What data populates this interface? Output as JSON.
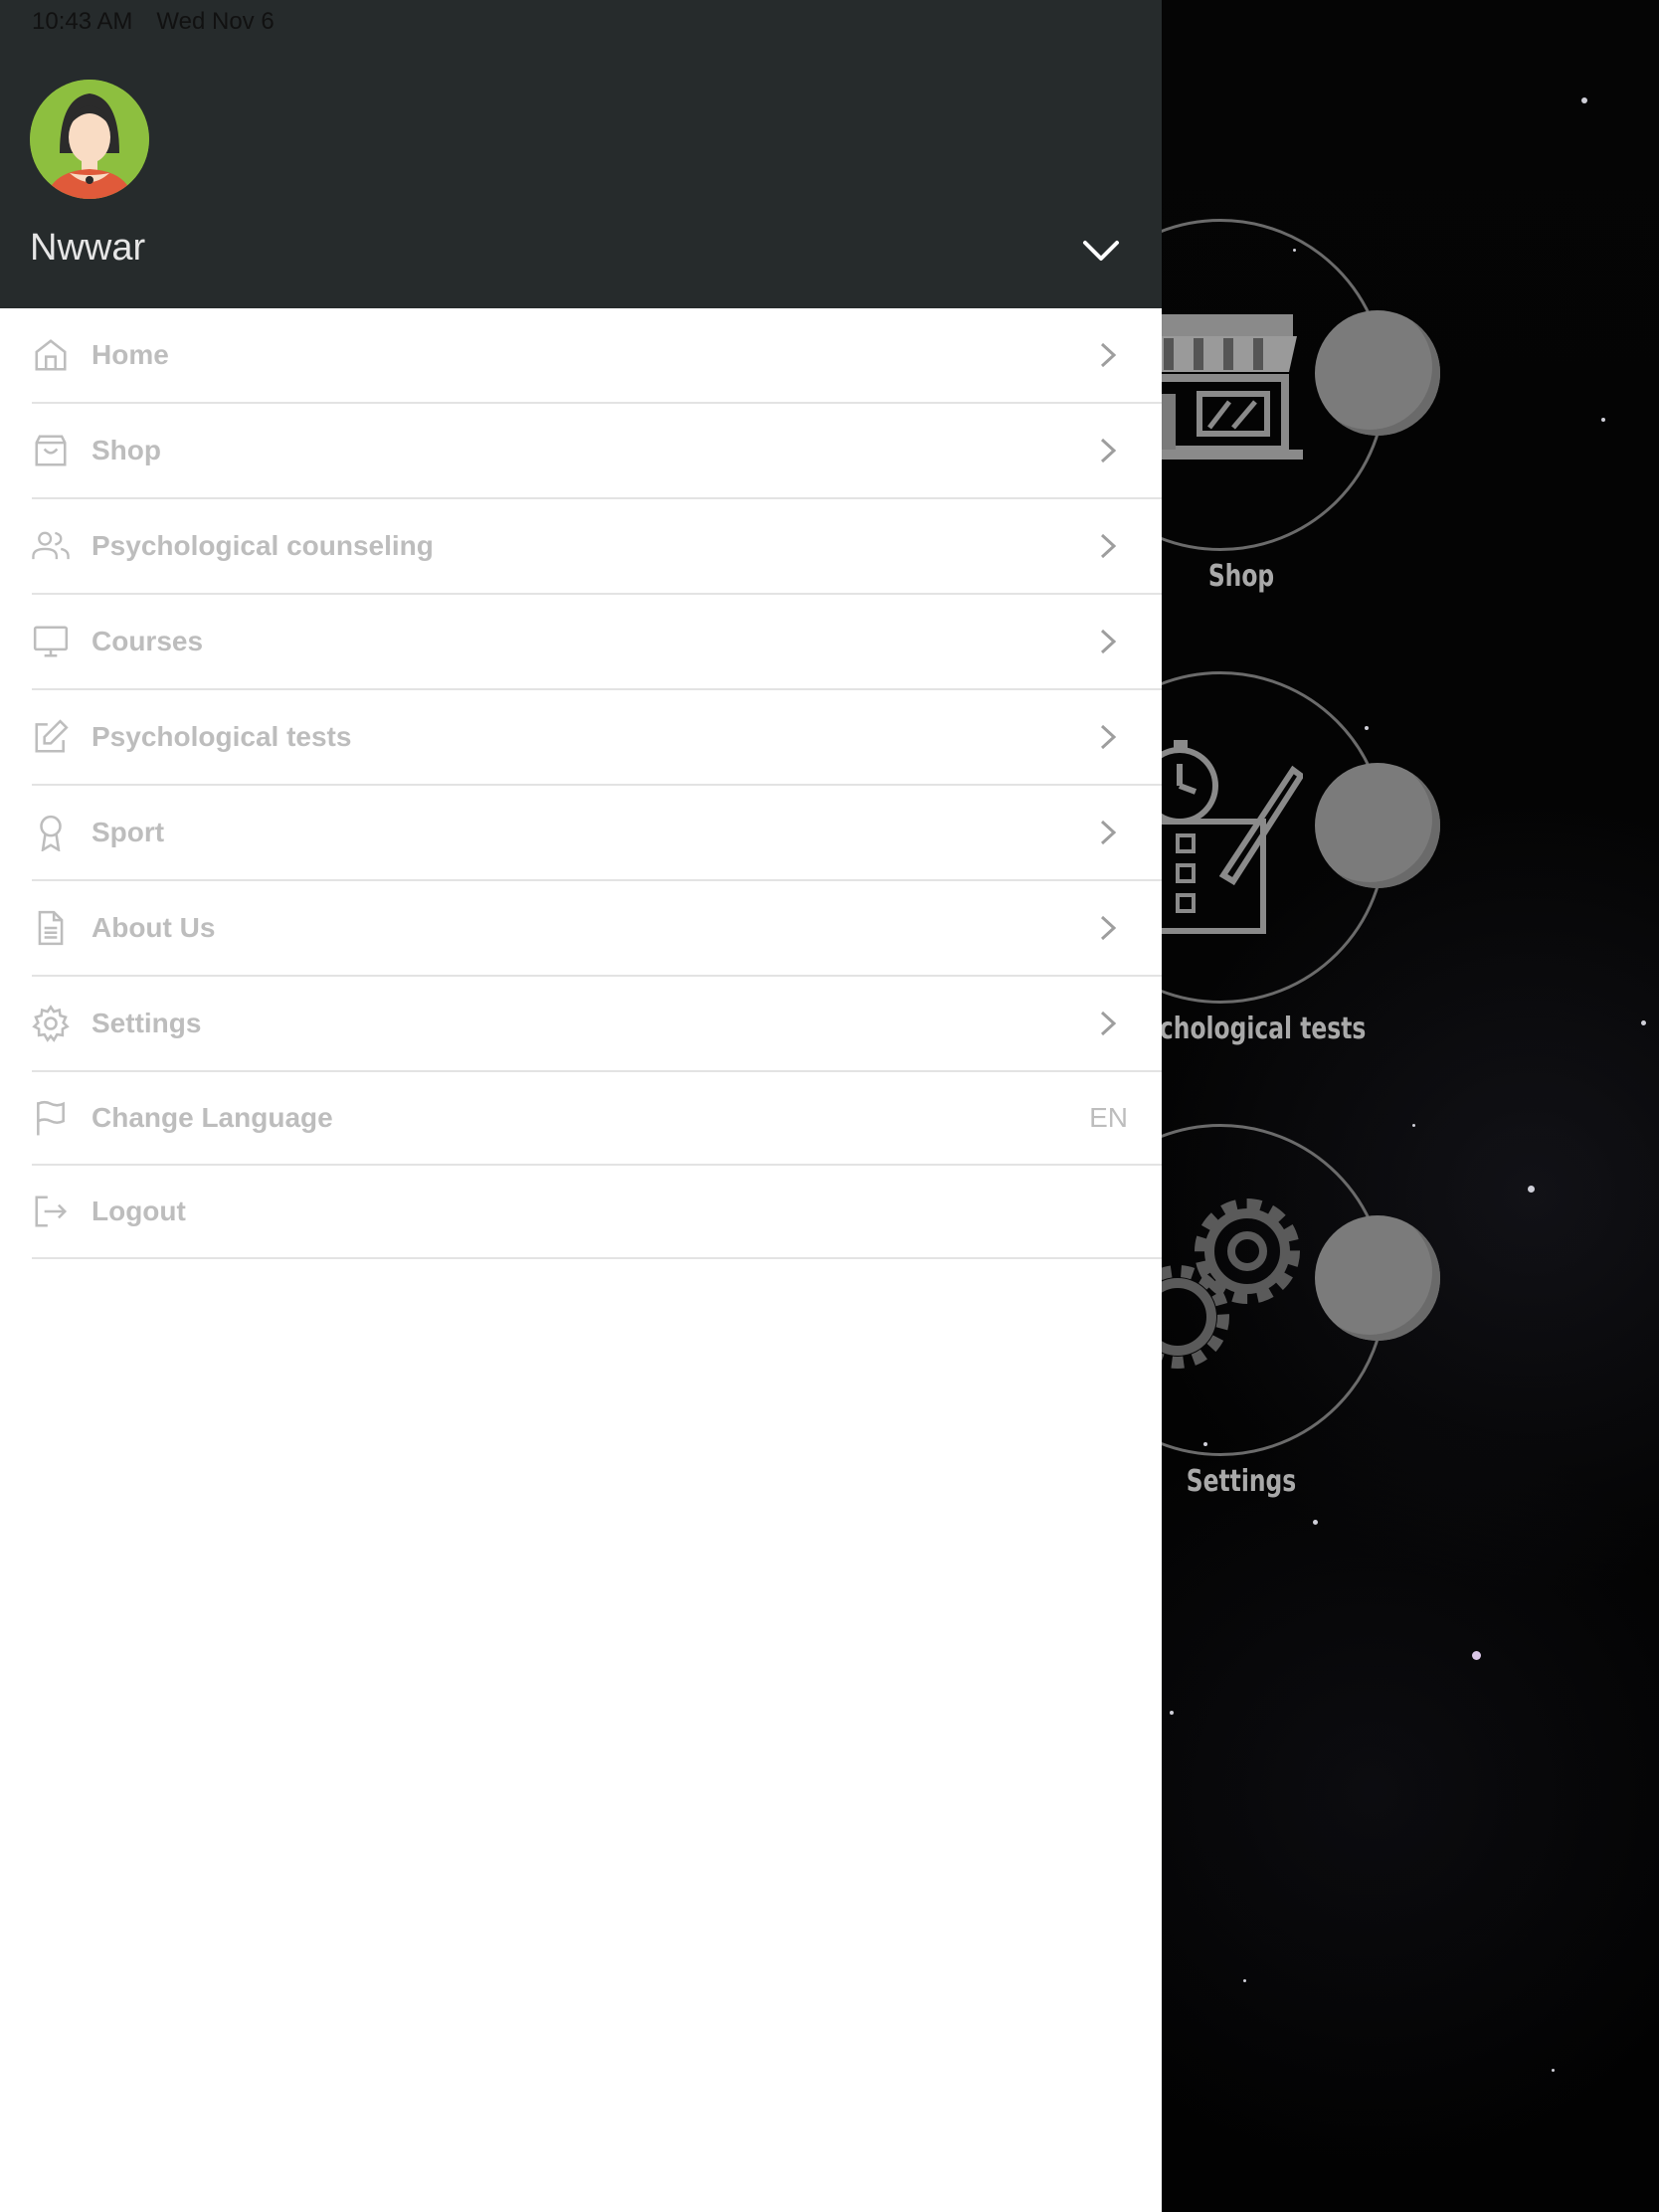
{
  "status_bar": {
    "time": "10:43 AM",
    "date": "Wed Nov 6"
  },
  "drawer": {
    "user_name": "Nwwar",
    "menu": [
      {
        "label": "Home",
        "icon": "home-icon"
      },
      {
        "label": "Shop",
        "icon": "shopping-bag-icon"
      },
      {
        "label": "Psychological counseling",
        "icon": "users-icon"
      },
      {
        "label": "Courses",
        "icon": "monitor-icon"
      },
      {
        "label": "Psychological tests",
        "icon": "edit-icon"
      },
      {
        "label": "Sport",
        "icon": "award-icon"
      },
      {
        "label": "About Us",
        "icon": "document-icon"
      },
      {
        "label": "Settings",
        "icon": "gear-icon"
      },
      {
        "label": "Change Language",
        "icon": "flag-icon",
        "value": "EN"
      },
      {
        "label": "Logout",
        "icon": "logout-icon"
      }
    ]
  },
  "background": {
    "tiles": [
      {
        "label": "Shop",
        "icon": "store-icon"
      },
      {
        "label": "ychological tests",
        "icon": "test-checklist-icon"
      },
      {
        "label": "Settings",
        "icon": "gears-icon"
      }
    ]
  },
  "colors": {
    "header_bg": "#262b2c",
    "menu_text": "#bdbdbd",
    "divider": "#e3e3e3",
    "avatar_bg": "#8dbf3f"
  }
}
